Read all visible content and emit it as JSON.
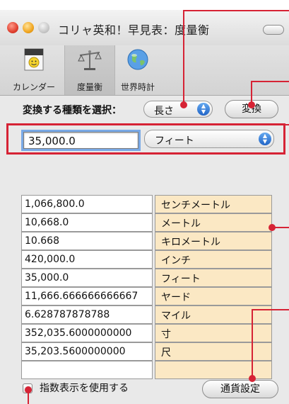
{
  "window": {
    "title": "コリャ英和！早見表：度量衡"
  },
  "toolbar": {
    "items": [
      {
        "label": "カレンダー",
        "icon": "calendar-icon"
      },
      {
        "label": "度量衡",
        "icon": "scale-icon",
        "selected": true
      },
      {
        "label": "世界時計",
        "icon": "globe-icon"
      }
    ]
  },
  "converter": {
    "select_label": "変換する種類を選択：",
    "category": "長さ",
    "convert_button": "変換",
    "input_value": "35,000.0",
    "unit": "フィート"
  },
  "results": [
    {
      "value": "1,066,800.0",
      "unit": "センチメートル"
    },
    {
      "value": "10,668.0",
      "unit": "メートル"
    },
    {
      "value": "10.668",
      "unit": "キロメートル"
    },
    {
      "value": "420,000.0",
      "unit": "インチ"
    },
    {
      "value": "35,000.0",
      "unit": "フィート"
    },
    {
      "value": "11,666.666666666667",
      "unit": "ヤード"
    },
    {
      "value": "6.628787878788",
      "unit": "マイル"
    },
    {
      "value": "352,035.6000000000",
      "unit": "寸"
    },
    {
      "value": "35,203.5600000000",
      "unit": "尺"
    },
    {
      "value": "",
      "unit": ""
    }
  ],
  "footer": {
    "exponent_checkbox_label": "指数表示を使用する",
    "exponent_checked": false,
    "currency_button": "通貨設定"
  },
  "colors": {
    "callout": "#d62335",
    "unit_cell_bg": "#fbe8c4",
    "popup_arrow_blue": "#1f63c6"
  }
}
